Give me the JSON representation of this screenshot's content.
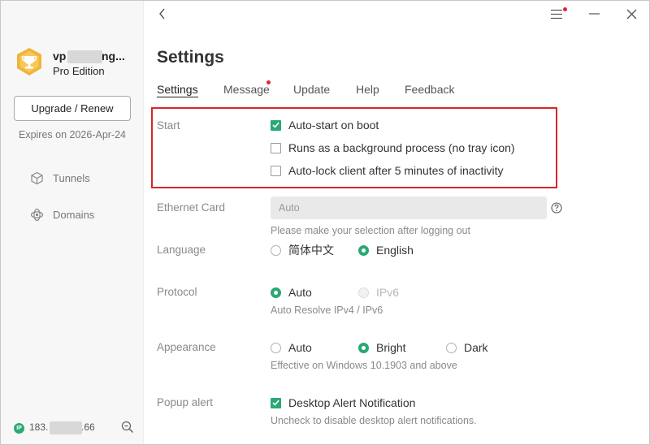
{
  "sidebar": {
    "username_start": "vp",
    "username_end": "ng...",
    "edition": "Pro Edition",
    "upgrade_label": "Upgrade / Renew",
    "expires": "Expires on 2026-Apr-24",
    "nav": [
      {
        "label": "Tunnels",
        "icon": "cube-icon"
      },
      {
        "label": "Domains",
        "icon": "domains-icon"
      }
    ],
    "ip_badge": "IP",
    "ip_start": "183.",
    "ip_end": ".66"
  },
  "page": {
    "title": "Settings",
    "tabs": [
      "Settings",
      "Message",
      "Update",
      "Help",
      "Feedback"
    ],
    "active_tab": "Settings",
    "message_has_notification": true
  },
  "settings": {
    "start": {
      "label": "Start",
      "options": [
        {
          "label": "Auto-start on boot",
          "checked": true
        },
        {
          "label": "Runs as a background process (no tray icon)",
          "checked": false
        },
        {
          "label": "Auto-lock client after 5 minutes of inactivity",
          "checked": false
        }
      ]
    },
    "ethernet": {
      "label": "Ethernet Card",
      "value": "Auto",
      "hint": "Please make your selection after logging out"
    },
    "language": {
      "label": "Language",
      "options": [
        "简体中文",
        "English"
      ],
      "selected": "English"
    },
    "protocol": {
      "label": "Protocol",
      "options": [
        "Auto",
        "IPv6"
      ],
      "selected": "Auto",
      "disabled": [
        "IPv6"
      ],
      "hint": "Auto Resolve IPv4 / IPv6"
    },
    "appearance": {
      "label": "Appearance",
      "options": [
        "Auto",
        "Bright",
        "Dark"
      ],
      "selected": "Bright",
      "hint": "Effective on Windows 10.1903 and above"
    },
    "popup": {
      "label": "Popup alert",
      "option": "Desktop Alert Notification",
      "checked": true,
      "hint": "Uncheck to disable desktop alert notifications."
    }
  },
  "colors": {
    "accent": "#2aa876",
    "notification": "#e8213a",
    "highlight_border": "#d9262c"
  }
}
